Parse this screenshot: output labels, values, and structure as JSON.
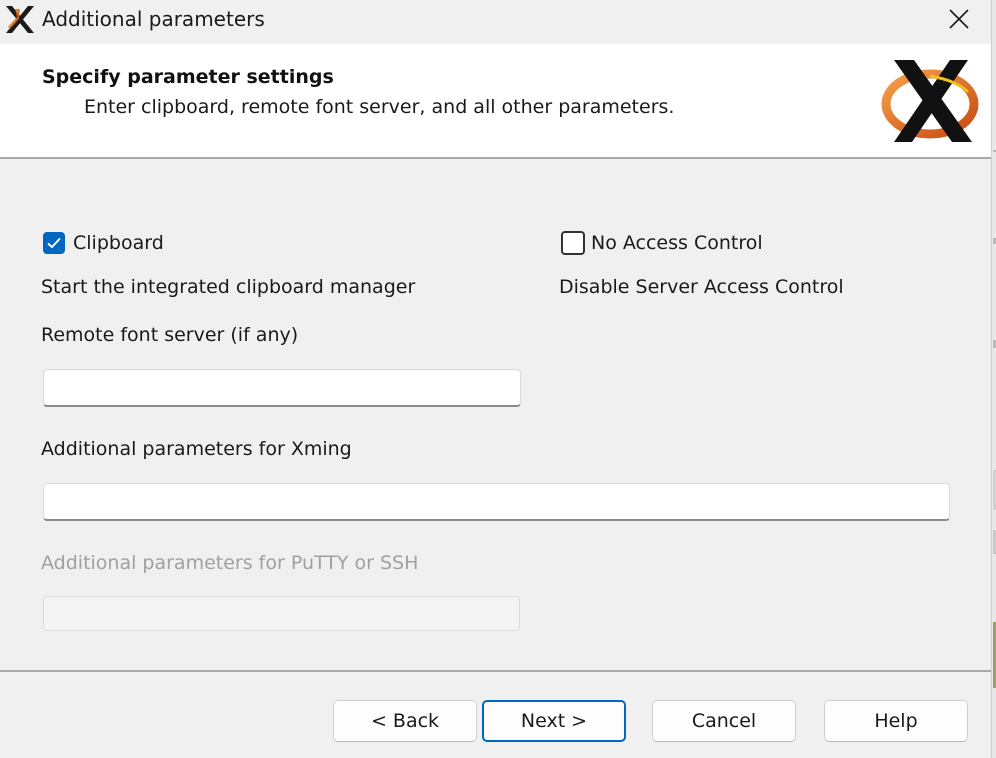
{
  "window": {
    "title": "Additional parameters",
    "app_icon": "xming-x-icon",
    "close_icon": "close-icon"
  },
  "header": {
    "title": "Specify parameter settings",
    "subtitle": "Enter clipboard, remote font server, and all other parameters.",
    "logo": "xming-logo"
  },
  "clipboard": {
    "label": "Clipboard",
    "checked": true,
    "description": "Start the integrated clipboard manager"
  },
  "no_access_control": {
    "label": "No Access Control",
    "checked": false,
    "description": "Disable Server Access Control"
  },
  "font_server": {
    "label": "Remote font server (if any)",
    "value": ""
  },
  "xming_params": {
    "label": "Additional parameters for Xming",
    "value": ""
  },
  "putty_params": {
    "label": "Additional parameters for PuTTY or SSH",
    "value": "",
    "disabled": true
  },
  "buttons": {
    "back": "< Back",
    "next": "Next >",
    "cancel": "Cancel",
    "help": "Help"
  },
  "colors": {
    "accent": "#0067c0",
    "logo_orange": "#e06a16",
    "disabled_text": "#a0a0a0"
  }
}
